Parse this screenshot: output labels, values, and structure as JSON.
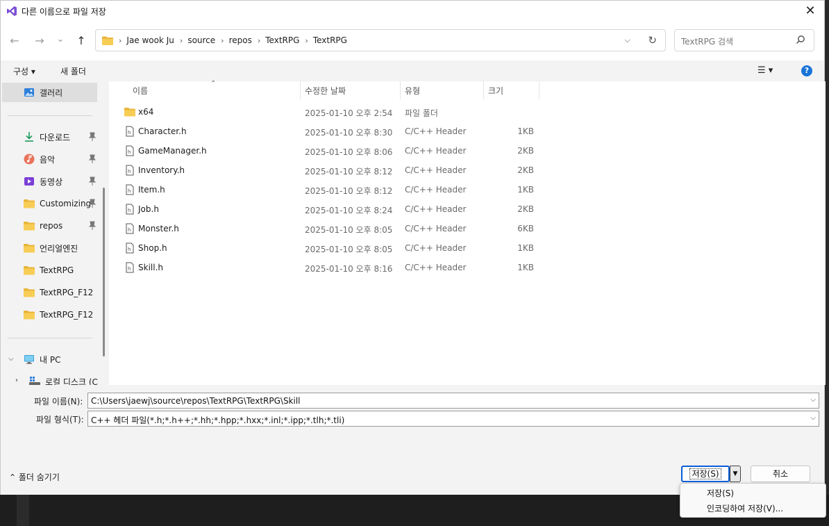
{
  "window": {
    "title": "다른 이름으로 파일 저장",
    "close_glyph": "✕"
  },
  "nav": {
    "back_glyph": "←",
    "forward_glyph": "→",
    "recent_glyph": "⌄",
    "up_glyph": "↑"
  },
  "address": {
    "crumbs": [
      "Jae wook Ju",
      "source",
      "repos",
      "TextRPG",
      "TextRPG"
    ]
  },
  "search": {
    "placeholder": "TextRPG 검색"
  },
  "commands": {
    "organize": "구성 ▾",
    "new_folder": "새 폴더",
    "view": "☰ ▾",
    "help": "?"
  },
  "sidebar": {
    "gallery": "갤러리",
    "quick": [
      {
        "label": "다운로드",
        "icon": "download-icon",
        "pinned": true
      },
      {
        "label": "음악",
        "icon": "music-icon",
        "pinned": true
      },
      {
        "label": "동영상",
        "icon": "video-icon",
        "pinned": true
      },
      {
        "label": "Customizing",
        "icon": "folder-icon",
        "pinned": true
      },
      {
        "label": "repos",
        "icon": "folder-icon",
        "pinned": true
      },
      {
        "label": "언리얼엔진",
        "icon": "folder-icon",
        "pinned": false
      },
      {
        "label": "TextRPG",
        "icon": "folder-icon",
        "pinned": false
      },
      {
        "label": "TextRPG_F12",
        "icon": "folder-icon",
        "pinned": false
      },
      {
        "label": "TextRPG_F12",
        "icon": "folder-icon",
        "pinned": false
      }
    ],
    "this_pc": "내 PC",
    "local_disk": "로컬 디스크 (C"
  },
  "columns": {
    "name": "이름",
    "modified": "수정한 날짜",
    "type": "유형",
    "size": "크기"
  },
  "files": [
    {
      "name": "x64",
      "date": "2025-01-10 오후 2:54",
      "type": "파일 폴더",
      "size": "",
      "icon": "folder-icon"
    },
    {
      "name": "Character.h",
      "date": "2025-01-10 오후 8:30",
      "type": "C/C++ Header",
      "size": "1KB",
      "icon": "header-file-icon"
    },
    {
      "name": "GameManager.h",
      "date": "2025-01-10 오후 8:06",
      "type": "C/C++ Header",
      "size": "2KB",
      "icon": "header-file-icon"
    },
    {
      "name": "Inventory.h",
      "date": "2025-01-10 오후 8:12",
      "type": "C/C++ Header",
      "size": "2KB",
      "icon": "header-file-icon"
    },
    {
      "name": "Item.h",
      "date": "2025-01-10 오후 8:12",
      "type": "C/C++ Header",
      "size": "1KB",
      "icon": "header-file-icon"
    },
    {
      "name": "Job.h",
      "date": "2025-01-10 오후 8:24",
      "type": "C/C++ Header",
      "size": "2KB",
      "icon": "header-file-icon"
    },
    {
      "name": "Monster.h",
      "date": "2025-01-10 오후 8:05",
      "type": "C/C++ Header",
      "size": "6KB",
      "icon": "header-file-icon"
    },
    {
      "name": "Shop.h",
      "date": "2025-01-10 오후 8:05",
      "type": "C/C++ Header",
      "size": "1KB",
      "icon": "header-file-icon"
    },
    {
      "name": "Skill.h",
      "date": "2025-01-10 오후 8:16",
      "type": "C/C++ Header",
      "size": "1KB",
      "icon": "header-file-icon"
    }
  ],
  "form": {
    "filename_label": "파일 이름(N):",
    "filename_value": "C:\\Users\\jaewj\\source\\repos\\TextRPG\\TextRPG\\Skill",
    "filetype_label": "파일 형식(T):",
    "filetype_value": "C++ 헤더 파일(*.h;*.h++;*.hh;*.hpp;*.hxx;*.inl;*.ipp;*.tlh;*.tli)"
  },
  "footer": {
    "hide_folders": "⌃ 폴더 숨기기",
    "save": "저장(S)",
    "save_arrow": "▼",
    "cancel": "취소"
  },
  "save_menu": {
    "items": [
      "저장(S)",
      "인코딩하여 저장(V)..."
    ]
  }
}
